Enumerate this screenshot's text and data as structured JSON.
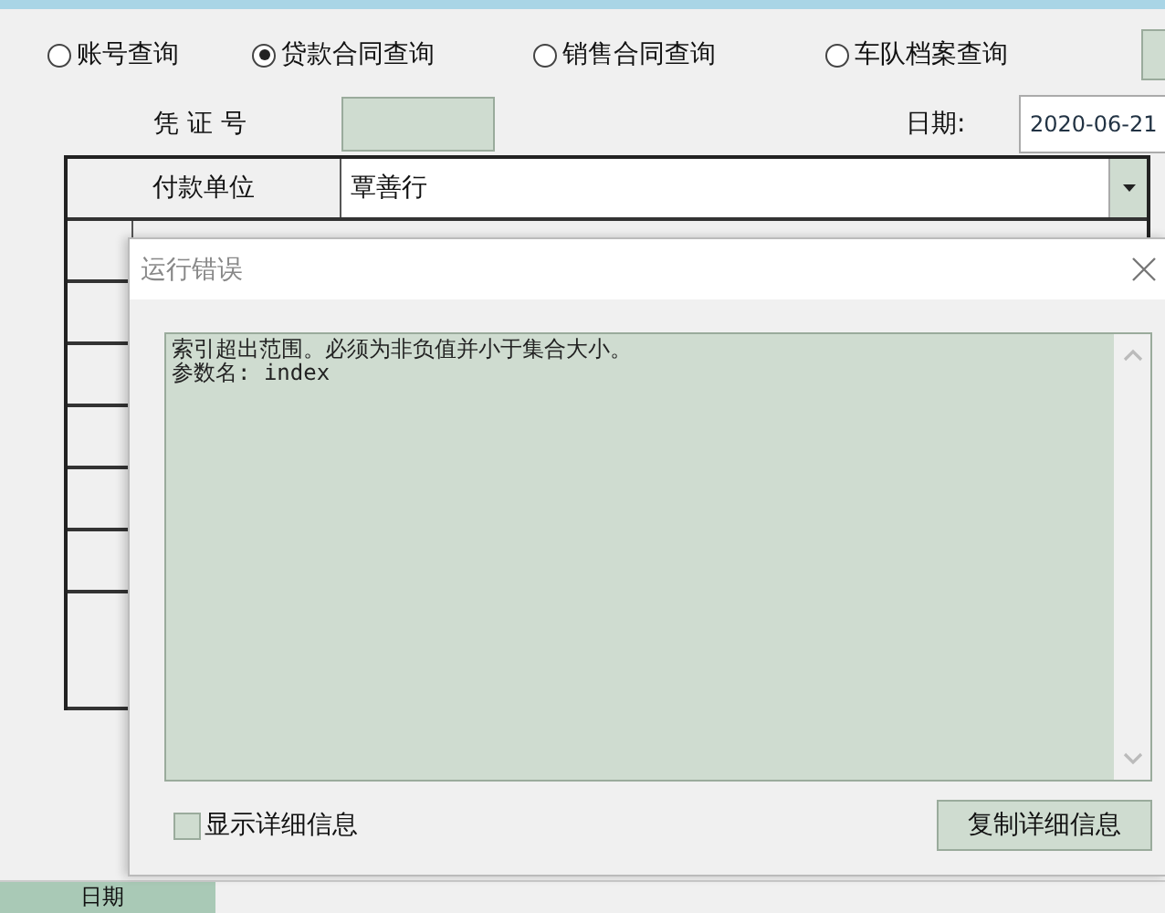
{
  "search_modes": [
    {
      "label": "账号查询",
      "selected": false
    },
    {
      "label": "贷款合同查询",
      "selected": true
    },
    {
      "label": "销售合同查询",
      "selected": false
    },
    {
      "label": "车队档案查询",
      "selected": false
    }
  ],
  "voucher": {
    "label": "凭 证 号"
  },
  "date": {
    "label": "日期:",
    "value": "2020-06-21"
  },
  "payer": {
    "label": "付款单位",
    "value": "覃善行"
  },
  "bottom_header": [
    "日期"
  ],
  "dialog": {
    "title": "运行错误",
    "message_lines": [
      "索引超出范围。必须为非负值并小于集合大小。",
      "参数名: index"
    ],
    "show_details": {
      "label": "显示详细信息",
      "checked": false
    },
    "copy_button": "复制详细信息"
  }
}
